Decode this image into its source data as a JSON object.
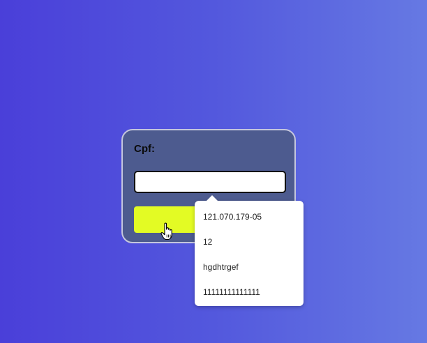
{
  "form": {
    "label": "Cpf:",
    "input_value": "",
    "button_label": ""
  },
  "autocomplete": {
    "options": [
      "121.070.179-05",
      "12",
      "hgdhtrgef",
      "11111111111111"
    ]
  },
  "colors": {
    "background_start": "#4a3fd9",
    "background_end": "#6679e3",
    "card": "#4d5b8f",
    "button": "#e3fb24"
  },
  "icons": {
    "cursor": "hand-pointer-icon"
  }
}
